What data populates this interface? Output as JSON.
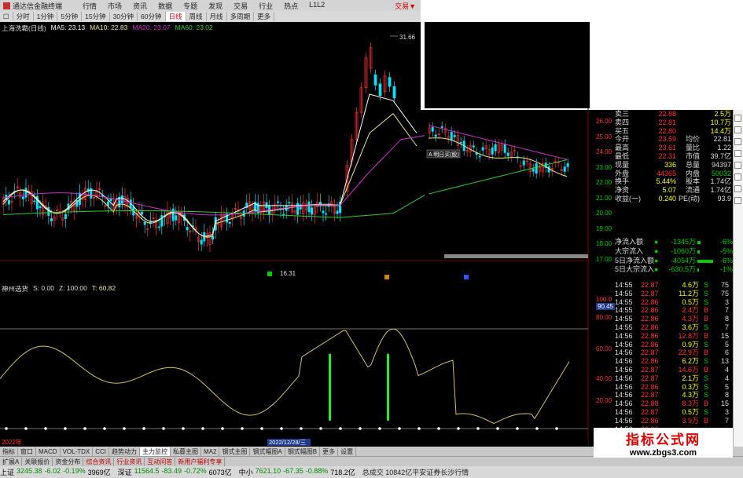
{
  "window": {
    "title": "通达信金融终端",
    "menu": [
      "行情",
      "市场",
      "资讯",
      "数据",
      "专题",
      "发现",
      "交易",
      "行业",
      "热点",
      "L1L2"
    ],
    "brand": "交易▼"
  },
  "periods": [
    "分时",
    "1分钟",
    "5分钟",
    "15分钟",
    "30分钟",
    "60分钟",
    "日线",
    "周线",
    "月线",
    "多周期",
    "更多"
  ],
  "active_period": "日线",
  "ma_line": {
    "stock": "上海洗霸(日线)",
    "ma5": "MA5: 23.13",
    "ma10": "MA10: 22.83",
    "ma20": "MA20: 23.07",
    "ma60": "MA60: 23.02"
  },
  "price_marks": {
    "high": "31.66",
    "low": "16.31",
    "popup": "A 明日买(股)"
  },
  "price_axis": [
    "26.00",
    "25.00",
    "24.00",
    "23.00",
    "22.00",
    "21.00",
    "20.00",
    "19.00",
    "18.00",
    "17.00"
  ],
  "indicator_line": {
    "name": "神州选货",
    "s": "S: 0.00",
    "z": "Z: 100.00",
    "t": "T: 60.82"
  },
  "indicator_axis": [
    "100.0",
    "90.45",
    "80.00",
    "60.00",
    "40.00",
    "20.00"
  ],
  "date_labels": {
    "start": "2022年",
    "mid": "2022/12/28/三"
  },
  "quote": [
    {
      "k": "卖三",
      "v": "22.88",
      "v2": "2.5万"
    },
    {
      "k": "卖四",
      "v": "22.81",
      "v2": "10.7万"
    },
    {
      "k": "买五",
      "v": "22.80",
      "v2": "14.4万"
    },
    {
      "k": "今开",
      "v": "23.59",
      "k2": "均价",
      "v2": "22.81"
    },
    {
      "k": "最高",
      "v": "23.61",
      "k2": "量比",
      "v2": "1.22"
    },
    {
      "k": "最低",
      "v": "22.31",
      "k2": "市值",
      "v2": "39.7亿"
    },
    {
      "k": "现量",
      "v": "336",
      "k2": "总量",
      "v2": "94397"
    },
    {
      "k": "外盘",
      "v": "44365",
      "k2": "内盘",
      "v2": "50032"
    },
    {
      "k": "换手",
      "v": "5.44%",
      "k2": "股本",
      "v2": "1.74亿"
    },
    {
      "k": "净资",
      "v": "5.07",
      "k2": "流通",
      "v2": "1.74亿"
    },
    {
      "k": "收益(一)",
      "v": "0.240",
      "k2": "PE(动)",
      "v2": "93.9"
    }
  ],
  "flow": [
    {
      "k": "净流入额",
      "v": "-1345万",
      "bar": 0.2,
      "p": "-6%"
    },
    {
      "k": "大宗流入",
      "v": "-1060万",
      "bar": 0.15,
      "p": "-5%"
    },
    {
      "k": "5日净流入额",
      "v": "-4054万",
      "bar": 0.9,
      "p": "-6%"
    },
    {
      "k": "5日大宗流入",
      "v": "-630.5万",
      "bar": 0.1,
      "p": "-1%"
    }
  ],
  "ticks": [
    {
      "t": "14:55",
      "pr": "22.87",
      "vol": "4.6万",
      "bs": "S",
      "n": "75"
    },
    {
      "t": "14:55",
      "pr": "22.87",
      "vol": "11.2万",
      "bs": "S",
      "n": "75"
    },
    {
      "t": "14:55",
      "pr": "22.86",
      "vol": "0.5万",
      "bs": "S",
      "n": "3"
    },
    {
      "t": "14:55",
      "pr": "22.86",
      "vol": "2.4万",
      "bs": "B",
      "n": "7"
    },
    {
      "t": "14:55",
      "pr": "22.86",
      "vol": "4.3万",
      "bs": "B",
      "n": "8"
    },
    {
      "t": "14:55",
      "pr": "22.86",
      "vol": "3.6万",
      "bs": "S",
      "n": "7"
    },
    {
      "t": "14:56",
      "pr": "22.86",
      "vol": "12.8万",
      "bs": "B",
      "n": "15"
    },
    {
      "t": "14:56",
      "pr": "22.86",
      "vol": "0.9万",
      "bs": "S",
      "n": "5"
    },
    {
      "t": "14:56",
      "pr": "22.87",
      "vol": "22.9万",
      "bs": "B",
      "n": "6"
    },
    {
      "t": "14:56",
      "pr": "22.86",
      "vol": "6.2万",
      "bs": "S",
      "n": "13"
    },
    {
      "t": "14:56",
      "pr": "22.87",
      "vol": "14.6万",
      "bs": "B",
      "n": "4"
    },
    {
      "t": "14:56",
      "pr": "22.87",
      "vol": "2.1万",
      "bs": "S",
      "n": "4"
    },
    {
      "t": "14:56",
      "pr": "22.86",
      "vol": "0.3万",
      "bs": "S",
      "n": "5"
    },
    {
      "t": "14:56",
      "pr": "22.87",
      "vol": "4.3万",
      "bs": "S",
      "n": "8"
    },
    {
      "t": "14:56",
      "pr": "22.88",
      "vol": "8.3万",
      "bs": "B",
      "n": "15"
    },
    {
      "t": "14:56",
      "pr": "22.87",
      "vol": "0.5万",
      "bs": "S",
      "n": "3"
    },
    {
      "t": "14:56",
      "pr": "22.86",
      "vol": "3.9万",
      "bs": "B",
      "n": "7"
    },
    {
      "t": "14:56",
      "pr": "22.86",
      "vol": "",
      "bs": "",
      "n": ""
    }
  ],
  "tabs": [
    "指标",
    "窗口",
    "MACD",
    "VOL-TDX",
    "CCI",
    "趋势动力",
    "主力监控",
    "私募主图",
    "MA2",
    "钢式主图",
    "钢式幅图A",
    "钢式幅图B",
    "更多",
    "设置"
  ],
  "tabs2": [
    "扩展A",
    "关联报价",
    "资金分布",
    "综合资讯",
    "行业资讯",
    "互动问答",
    "新用户福利专享"
  ],
  "status": [
    {
      "name": "上证",
      "v1": "3245.38",
      "v2": "-6.02",
      "v3": "-0.19%",
      "v4": "3969亿"
    },
    {
      "name": "深证",
      "v1": "11564.5",
      "v2": "-83.49",
      "v3": "-0.72%",
      "v4": "6073亿"
    },
    {
      "name": "中小",
      "v1": "7621.10",
      "v2": "-67.35",
      "v3": "-0.88%",
      "v4": "718.2亿"
    }
  ],
  "status_tail": "总成交 10842亿平安证券长沙行情",
  "watermark": {
    "line1": "指标公式网",
    "line2": "www.zbgs3.com"
  },
  "colors": {
    "up": "#ff3333",
    "down": "#00e5ff",
    "ma5": "#ffffff",
    "ma10": "#f0e68c",
    "ma20": "#cc33cc",
    "ma60": "#33cc33",
    "osc": "#d4c06a",
    "signal": "#22ee22"
  }
}
